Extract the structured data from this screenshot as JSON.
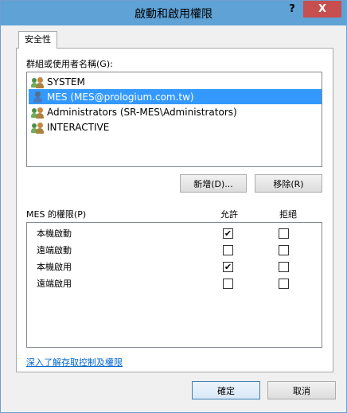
{
  "window": {
    "title": "啟動和啟用權限",
    "help_label": "?",
    "close_label": "X"
  },
  "tabs": [
    {
      "label": "安全性",
      "active": true
    }
  ],
  "groups": {
    "label": "群組或使用者名稱(G):",
    "items": [
      {
        "name": "SYSTEM",
        "icon": "group-icon",
        "selected": false
      },
      {
        "name": "MES (MES@prologium.com.tw)",
        "icon": "user-icon",
        "selected": true
      },
      {
        "name": "Administrators (SR-MES\\Administrators)",
        "icon": "group-icon",
        "selected": false
      },
      {
        "name": "INTERACTIVE",
        "icon": "group-icon",
        "selected": false
      }
    ],
    "add_label": "新增(D)...",
    "remove_label": "移除(R)"
  },
  "permissions": {
    "label": "MES 的權限(P)",
    "allow_header": "允許",
    "deny_header": "拒絕",
    "rows": [
      {
        "name": "本機啟動",
        "allow": true,
        "deny": false
      },
      {
        "name": "遠端啟動",
        "allow": false,
        "deny": false
      },
      {
        "name": "本機啟用",
        "allow": true,
        "deny": false
      },
      {
        "name": "遠端啟用",
        "allow": false,
        "deny": false
      }
    ]
  },
  "link_label": "深入了解存取控制及權限",
  "footer": {
    "ok_label": "確定",
    "cancel_label": "取消"
  },
  "colors": {
    "titlebar": "#5ea2d6",
    "close": "#c74f4f",
    "selection": "#3399ff",
    "link": "#0066cc"
  }
}
